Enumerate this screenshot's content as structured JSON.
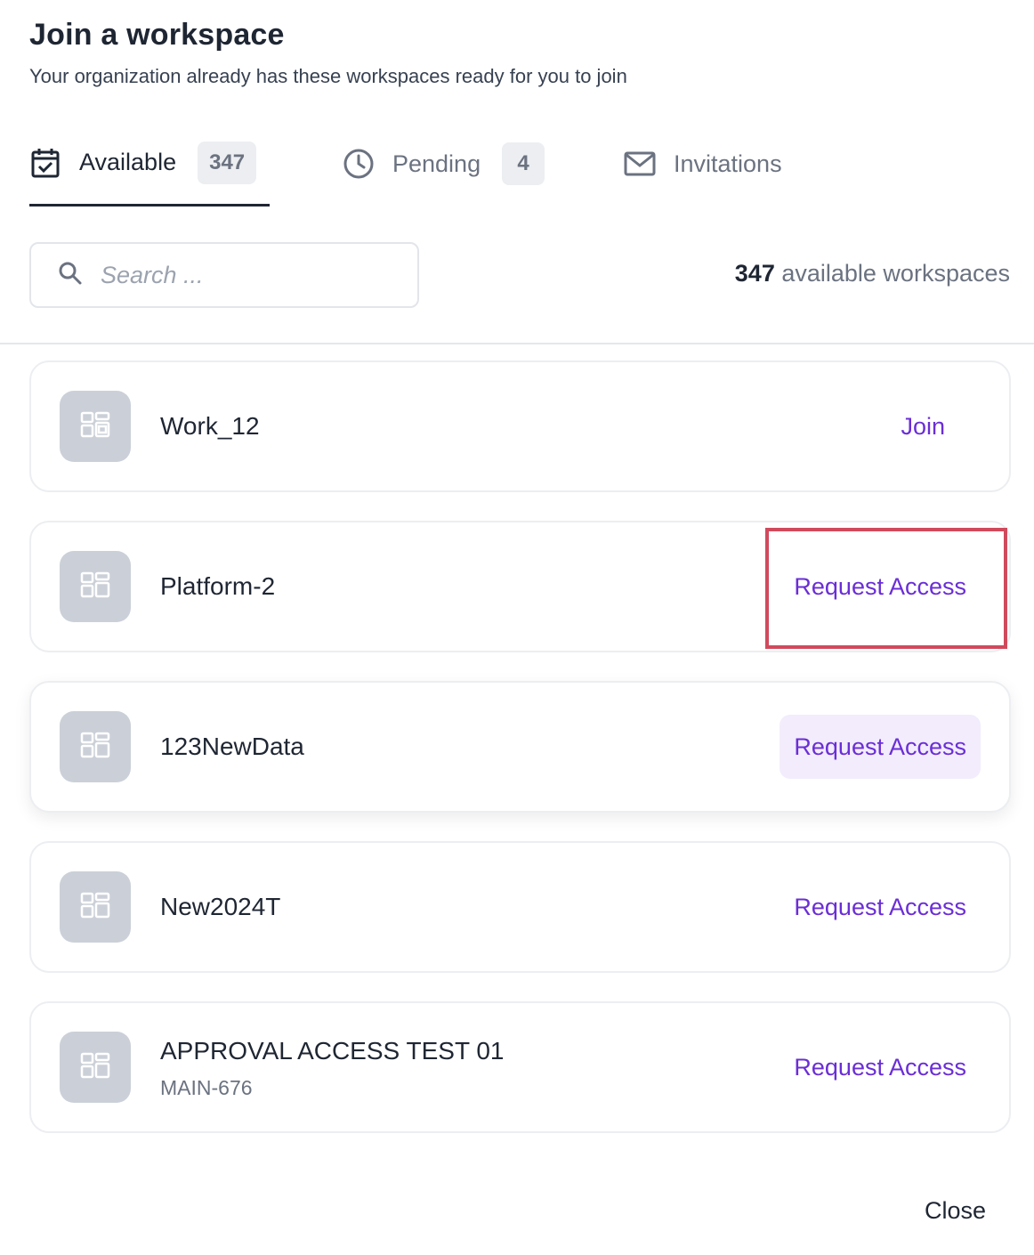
{
  "header": {
    "title": "Join a workspace",
    "subtitle": "Your organization already has these workspaces ready for you to join"
  },
  "tabs": [
    {
      "label": "Available",
      "count": "347",
      "icon": "calendar-check-icon",
      "active": true
    },
    {
      "label": "Pending",
      "count": "4",
      "icon": "clock-icon",
      "active": false
    },
    {
      "label": "Invitations",
      "icon": "mail-icon",
      "active": false
    }
  ],
  "search": {
    "placeholder": "Search ..."
  },
  "summary": {
    "count": "347",
    "label": "available workspaces"
  },
  "workspaces": [
    {
      "name": "Work_12",
      "action": "Join"
    },
    {
      "name": "Platform-2",
      "action": "Request Access"
    },
    {
      "name": "123NewData",
      "action": "Request Access"
    },
    {
      "name": "New2024T",
      "action": "Request Access"
    },
    {
      "name": "APPROVAL ACCESS TEST 01",
      "sub": "MAIN-676",
      "action": "Request Access"
    }
  ],
  "footer": {
    "close_label": "Close"
  },
  "colors": {
    "accent": "#6b2ed6",
    "highlight": "#d04a5c",
    "avatar_bg": "#cbd0d8"
  }
}
